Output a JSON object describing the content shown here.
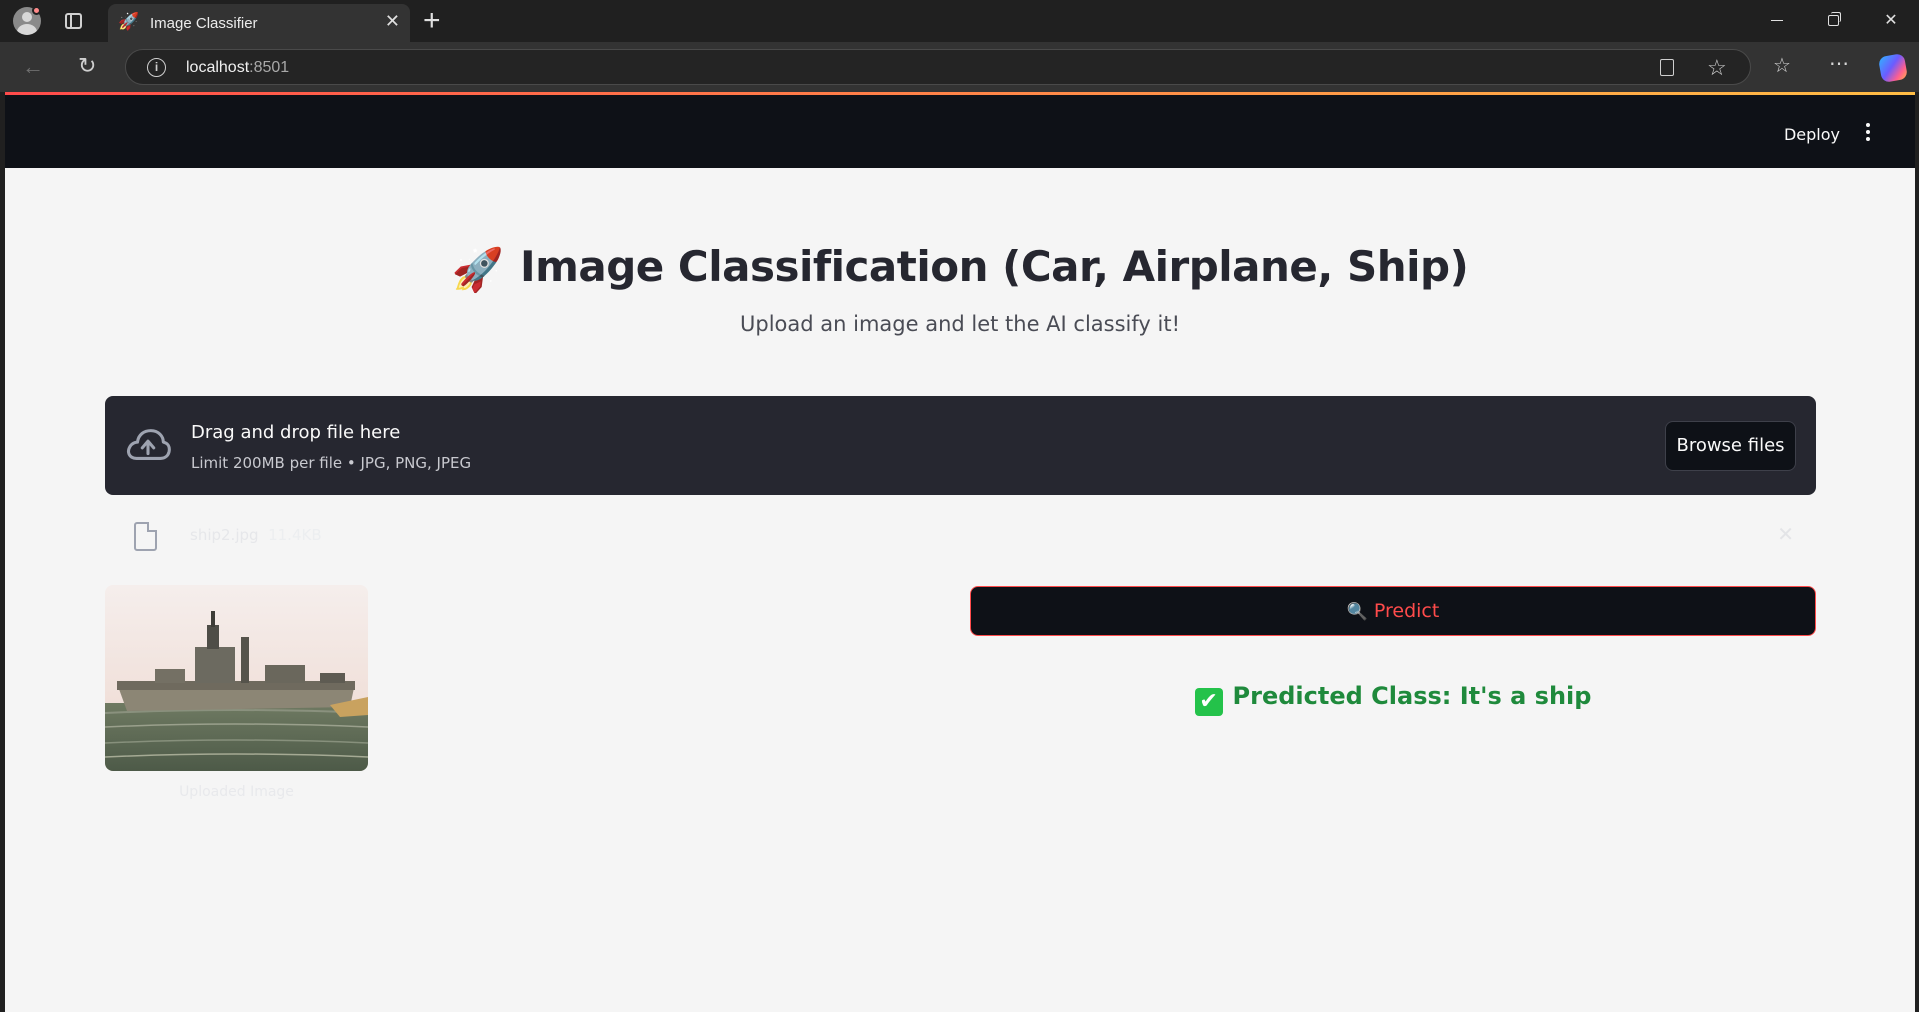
{
  "browser": {
    "tab_title": "Image Classifier",
    "tab_favicon": "🚀",
    "url_host": "localhost",
    "url_port": ":8501",
    "new_tab_glyph": "+",
    "close_tab_glyph": "✕"
  },
  "app_header": {
    "deploy_label": "Deploy"
  },
  "main": {
    "title_icon": "🚀",
    "title": "Image Classification (Car, Airplane, Ship)",
    "subtitle": "Upload an image and let the AI classify it!"
  },
  "uploader": {
    "drag_text": "Drag and drop file here",
    "limit_text": "Limit 200MB per file • JPG, PNG, JPEG",
    "browse_label": "Browse files",
    "file": {
      "name": "ship2.jpg",
      "size": "11.4KB"
    }
  },
  "image": {
    "caption": "Uploaded Image"
  },
  "predict": {
    "icon": "🔍",
    "label": "Predict"
  },
  "result": {
    "icon": "✔",
    "text": "Predicted Class: It's a ship"
  },
  "colors": {
    "accent": "#ff4b4b",
    "header_bg": "#0e1117",
    "dropzone_bg": "#262730",
    "success": "#1f8a3c",
    "page_bg": "#f5f5f5"
  }
}
